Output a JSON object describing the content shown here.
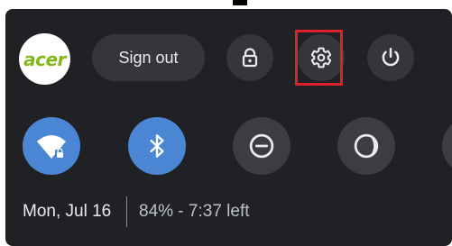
{
  "top_row": {
    "avatar_logo": "acer",
    "sign_out_label": "Sign out",
    "lock_icon": "lock-icon",
    "settings_icon": "gear-icon",
    "power_icon": "power-icon"
  },
  "tiles": [
    {
      "name": "wifi",
      "icon": "wifi-lock-icon",
      "state": "on"
    },
    {
      "name": "bluetooth",
      "icon": "bluetooth-icon",
      "state": "on"
    },
    {
      "name": "do-not-disturb",
      "icon": "minus-circle-icon",
      "state": "off"
    },
    {
      "name": "night-light",
      "icon": "moon-icon",
      "state": "off"
    }
  ],
  "status": {
    "date": "Mon, Jul 16",
    "battery": "84% - 7:37 left"
  },
  "colors": {
    "panel": "#202124",
    "button": "#35363a",
    "tile_on": "#4b86d4",
    "tile_off": "#3c3d41",
    "highlight": "#e0202a",
    "avatar_logo": "#83b81a"
  }
}
